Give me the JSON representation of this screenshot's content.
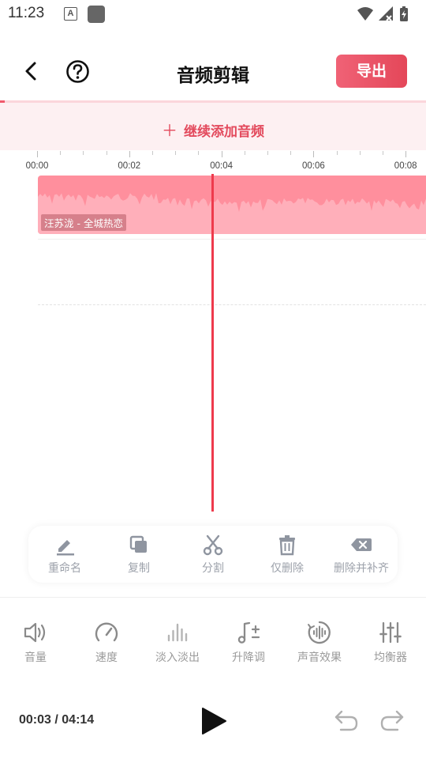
{
  "status_bar": {
    "time": "11:23",
    "notification_letter": "A"
  },
  "header": {
    "title": "音频剪辑",
    "export_label": "导出"
  },
  "add_audio": {
    "plus": "＋",
    "label": "继续添加音频"
  },
  "timeline": {
    "ticks": [
      "00:00",
      "00:02",
      "00:04",
      "00:06",
      "00:08"
    ],
    "track_label": "汪苏泷 - 全城热恋",
    "progress": 0.012
  },
  "edit_tools": [
    {
      "label": "重命名",
      "icon": "pencil-icon"
    },
    {
      "label": "复制",
      "icon": "copy-icon"
    },
    {
      "label": "分割",
      "icon": "scissors-icon"
    },
    {
      "label": "仅删除",
      "icon": "trash-icon"
    },
    {
      "label": "删除并补齐",
      "icon": "backspace-icon"
    }
  ],
  "effects": [
    {
      "label": "音量",
      "icon": "volume-icon"
    },
    {
      "label": "速度",
      "icon": "speedometer-icon"
    },
    {
      "label": "淡入淡出",
      "icon": "fade-bars-icon"
    },
    {
      "label": "升降调",
      "icon": "pitch-note-icon"
    },
    {
      "label": "声音效果",
      "icon": "voice-effect-icon"
    },
    {
      "label": "均衡器",
      "icon": "equalizer-icon"
    }
  ],
  "playback": {
    "current": "00:03",
    "separator": " / ",
    "total": "04:14"
  },
  "colors": {
    "accent": "#e44759",
    "track": "#ff8f9d",
    "playhead": "#ee3a4c",
    "add_bg": "#fdf0f2",
    "inactive": "#9da2ab"
  }
}
